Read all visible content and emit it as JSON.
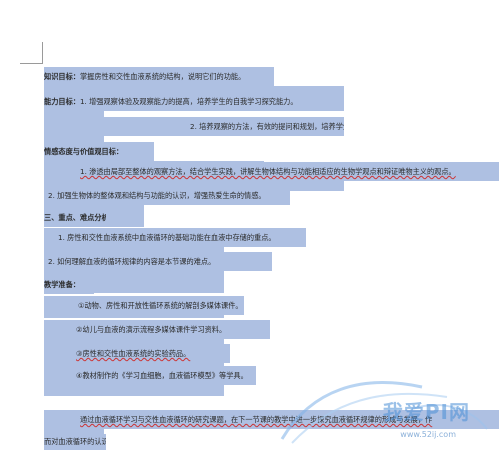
{
  "document": {
    "lines": [
      {
        "label": "知识目标：",
        "text": "掌握房性和交性血液系统的结构，说明它们的功能。"
      },
      {
        "label": "能力目标：",
        "text": "1. 增强观察体验及观察能力的提高，培养学生的自我学习探究能力。"
      },
      {
        "label": "",
        "text": "2. 培养观察的方法，有效的提问和规划，培养学生的识图能力。"
      },
      {
        "label": "情感态度与价值观目标：",
        "text": ""
      },
      {
        "label": "",
        "text": "1. 渗透由局部至整体的观察方法，结合学生实践，讲解生物体结构与功能相适应的生物学观点和辩证唯物主义的观点。"
      },
      {
        "label": "",
        "text": "2. 加强生物体的整体观和结构与功能的认识，增强热爱生命的情感。"
      },
      {
        "label": "三、重点、难点分析",
        "text": ""
      },
      {
        "label": "",
        "text": "1. 房性和交性血液系统中血液循环的基础功能在血液中存储的重点。"
      },
      {
        "label": "",
        "text": "2. 如何理解血液的循环规律的内容是本节课的难点。"
      },
      {
        "label": "教学准备：",
        "text": ""
      },
      {
        "label": "",
        "text": "①动物、房性和开放性循环系统的解剖多媒体课件。"
      },
      {
        "label": "",
        "text": "②幼儿与血液的演示流程多媒体课件学习资料。"
      },
      {
        "label": "",
        "text": "③房性和交性血液系统的实验药品。"
      },
      {
        "label": "",
        "text": "④教材制作的《学习血细胞，血液循环模型》等学具。"
      },
      {
        "label": "",
        "text": "通过血液循环学习与交性血液循环的研究课题，在下一节课的教学中进一步探究血液循环规律的形成与发展，作"
      },
      {
        "label": "",
        "text": "而对血液循环的认识。"
      }
    ]
  },
  "watermark": {
    "brand": "我爱PI网",
    "url": "www.52ij.com"
  },
  "colors": {
    "selection": "#aec0e2",
    "watermark": "#4b8fd6"
  }
}
